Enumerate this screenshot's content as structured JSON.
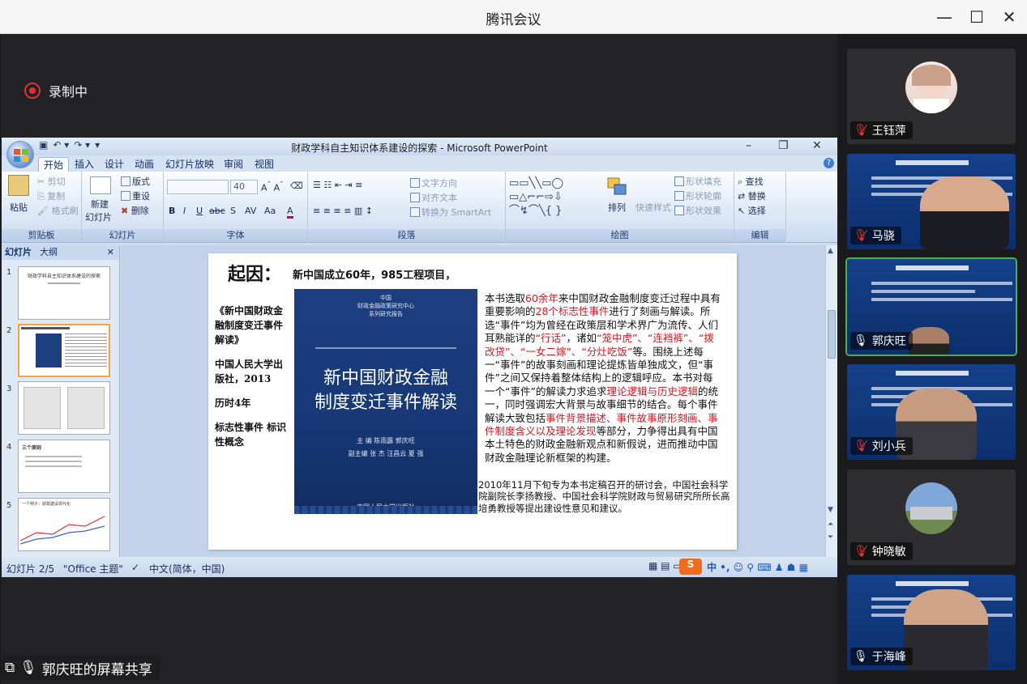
{
  "app": {
    "window_title": "腾讯会议",
    "recording_label": "录制中",
    "share_label": "郭庆旺的屏幕共享"
  },
  "participants": [
    {
      "name": "王钰萍",
      "muted": true
    },
    {
      "name": "马骁",
      "muted": true
    },
    {
      "name": "郭庆旺",
      "muted": false,
      "active_speaker": true
    },
    {
      "name": "刘小兵",
      "muted": true
    },
    {
      "name": "钟晓敏",
      "muted": true
    },
    {
      "name": "于海峰",
      "muted": false
    }
  ],
  "ppt": {
    "window_title": "财政学科自主知识体系建设的探索 - Microsoft PowerPoint",
    "tabs": [
      "开始",
      "插入",
      "设计",
      "动画",
      "幻灯片放映",
      "审阅",
      "视图"
    ],
    "selected_tab": "开始",
    "groups": {
      "clipboard": {
        "label": "剪贴板",
        "paste": "粘贴",
        "cut": "剪切",
        "copy": "复制",
        "format_painter": "格式刷"
      },
      "slides": {
        "label": "幻灯片",
        "new_slide_1": "新建",
        "new_slide_2": "幻灯片",
        "layout": "版式",
        "reset": "重设",
        "delete": "删除"
      },
      "font": {
        "label": "字体",
        "font_size": "40"
      },
      "paragraph": {
        "label": "段落",
        "text_direction": "文字方向",
        "align_text": "对齐文本",
        "smartart": "转换为 SmartArt"
      },
      "drawing": {
        "label": "绘图",
        "arrange": "排列",
        "quick_styles": "快速样式",
        "shape_fill": "形状填充",
        "shape_outline": "形状轮廓",
        "shape_effects": "形状效果"
      },
      "editing": {
        "label": "编辑",
        "find": "查找",
        "replace": "替换",
        "select": "选择"
      }
    },
    "panel_tabs": [
      "幻灯片",
      "大纲"
    ],
    "thumb_numbers": [
      "1",
      "2",
      "3",
      "4",
      "5"
    ],
    "thumb1_title": "财政学科自主知识体系建设的探索",
    "thumb4_title": "三个原则",
    "thumb5_title": "一个例子：财政建设现代化",
    "status": {
      "slide_index": "幻灯片 2/5",
      "theme": "\"Office 主题\"",
      "language": "中文(简体，中国)"
    }
  },
  "slide": {
    "title": "起因：",
    "subtitle": "新中国成立60年，985工程项目，",
    "left_lines": [
      "《新中国财政金融制度变迁事件解读》",
      "中国人民大学出版社，2013",
      "历时4年",
      "标志性事件 标识性概念"
    ],
    "book": {
      "series_1": "中国",
      "series_2": "财政金融政策研究中心",
      "series_3": "系列研究报告",
      "title_line1": "新中国财政金融",
      "title_line2": "制度变迁事件解读",
      "editors_1": "主 编   陈雨露   郭庆旺",
      "editors_2": "副主编   张 杰   汪昌云   夏 强",
      "publisher": "中国人民大学出版社"
    },
    "para_segments": [
      {
        "t": "本书选取",
        "red": false
      },
      {
        "t": "60余年",
        "red": true
      },
      {
        "t": "来中国财政金融制度变迁过程中具有重要影响的",
        "red": false
      },
      {
        "t": "28个标志性事件",
        "red": true
      },
      {
        "t": "进行了刻画与解读。所选“事件”均为曾经在政策层和学术界广为流传、人们耳熟能详的",
        "red": false
      },
      {
        "t": "“行话”",
        "red": true
      },
      {
        "t": "，诸如",
        "red": false
      },
      {
        "t": "“笼中虎”、“连裆裤”、“拨改贷”、“一女二嫁”、“分灶吃饭”",
        "red": true
      },
      {
        "t": "等。围绕上述每一“事件”的故事刻画和理论提炼皆单独成文，但“事件”之间又保持着整体结构上的逻辑呼应。本书对每一个“事件”的解读力求追求",
        "red": false
      },
      {
        "t": "理论逻辑与历史逻辑",
        "red": true
      },
      {
        "t": "的统一，同时强调宏大背景与故事细节的结合。每个事件解读大致包括",
        "red": false
      },
      {
        "t": "事件背景描述、事件故事原形刻画、事件制度含义以及理论发现",
        "red": true
      },
      {
        "t": "等部分，力争得出具有中国本土特色的财政金融新观点和新假说，进而推动中国财政金融理论新框架的构建。",
        "red": false
      }
    ],
    "para2": "2010年11月下旬专为本书定稿召开的研讨会，中国社会科学院副院长李扬教授、中国社会科学院财政与贸易研究所所长高培勇教授等提出建设性意见和建议。"
  },
  "colors": {
    "accent_red": "#e0141e",
    "book_blue": "#173875",
    "active_green": "#4caf50",
    "record_red": "#e0313b"
  }
}
